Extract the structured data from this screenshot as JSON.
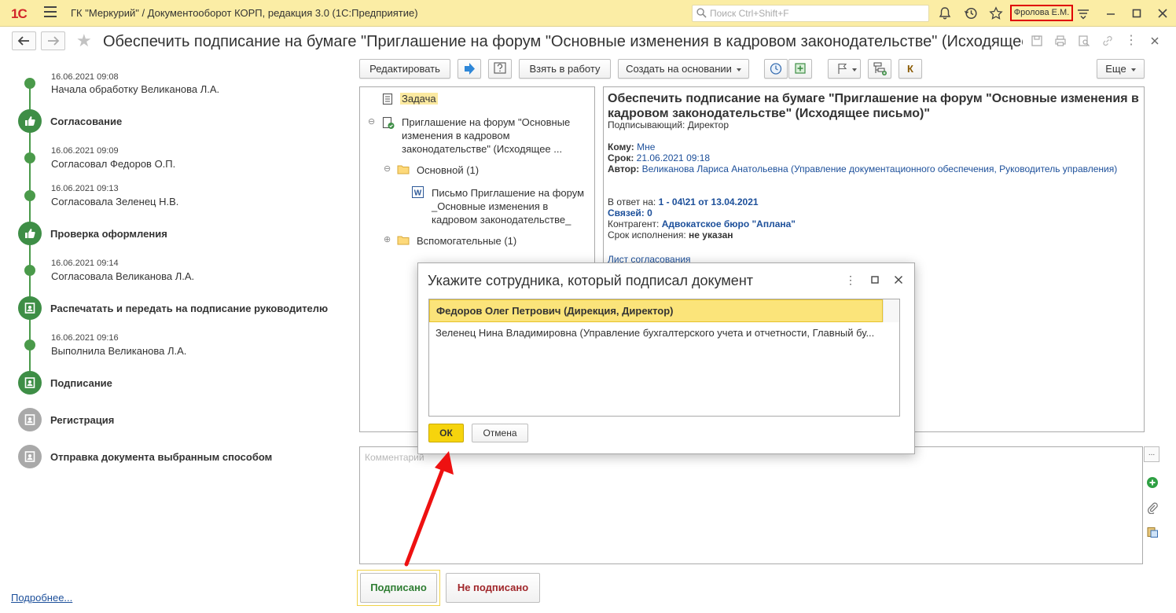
{
  "titlebar": {
    "logo": "1С",
    "app_title": "ГК \"Меркурий\" / Документооборот КОРП, редакция 3.0  (1С:Предприятие)",
    "search_placeholder": "Поиск Ctrl+Shift+F",
    "user": "Фролова Е.М."
  },
  "form": {
    "title": "Обеспечить подписание на бумаге \"Приглашение на форум \"Основные изменения в кадровом законодательстве\" (Исходящее пис..."
  },
  "timeline": {
    "entries": [
      {
        "date": "16.06.2021 09:08",
        "text": "Начала обработку Великанова Л.А."
      },
      {
        "stage": "Согласование"
      },
      {
        "date": "16.06.2021 09:09",
        "text": "Согласовал Федоров О.П."
      },
      {
        "date": "16.06.2021 09:13",
        "text": "Согласовала Зеленец Н.В."
      },
      {
        "stage": "Проверка оформления"
      },
      {
        "date": "16.06.2021 09:14",
        "text": "Согласовала Великанова Л.А."
      },
      {
        "stage": "Распечатать и передать на подписание руководителю"
      },
      {
        "date": "16.06.2021 09:16",
        "text": "Выполнила Великанова Л.А."
      },
      {
        "stage": "Подписание"
      },
      {
        "stage": "Регистрация"
      },
      {
        "stage": "Отправка документа выбранным способом"
      }
    ],
    "more_link": "Подробнее..."
  },
  "toolbar": {
    "edit": "Редактировать",
    "take_to_work": "Взять в работу",
    "create_based_on": "Создать на основании",
    "more": "Еще",
    "k_button": "К"
  },
  "tree": {
    "task": "Задача",
    "document": "Приглашение на форум \"Основные изменения в кадровом законодательстве\" (Исходящее ...",
    "main_folder": "Основной (1)",
    "file": "Письмо Приглашение на форум _Основные изменения в кадровом законодательстве_",
    "aux_folder": "Вспомогательные (1)"
  },
  "detail": {
    "title": "Обеспечить подписание на бумаге \"Приглашение на форум \"Основные изменения в кадровом законодательстве\" (Исходящее письмо)\"",
    "signer_label": "Подписывающий: Директор",
    "to_label": "Кому:",
    "to_value": "Мне",
    "deadline_label": "Срок:",
    "deadline_value": "21.06.2021 09:18",
    "author_label": "Автор:",
    "author_value": "Великанова Лариса Анатольевна (Управление документационного обеспечения, Руководитель управления)",
    "reply_label": "В ответ на:",
    "reply_value": "1 - 04\\21 от 13.04.2021",
    "links_label": "Связей: 0",
    "counterparty_label": "Контрагент:",
    "counterparty_value": "Адвокатское бюро \"Аплана\"",
    "exec_label": "Срок исполнения:",
    "exec_value": "не указан",
    "approval_sheet": "Лист согласования"
  },
  "comment": {
    "placeholder": "Комментарий",
    "dots": "..."
  },
  "actions": {
    "signed": "Подписано",
    "not_signed": "Не подписано"
  },
  "modal": {
    "title": "Укажите сотрудника, который подписал документ",
    "rows": [
      "Федоров Олег Петрович (Дирекция, Директор)",
      "Зеленец Нина Владимировна (Управление бухгалтерского учета и отчетности, Главный бу..."
    ],
    "ok": "ОК",
    "cancel": "Отмена"
  },
  "colors": {
    "titlebar_bg": "#fbeda5",
    "accent_green": "#3e8e46",
    "signed_text": "#2e7d32",
    "not_signed_text": "#a0262a",
    "ok_bg": "#f6d40d",
    "link": "#1c4f9a",
    "highlight_box": "#e00000",
    "arrow": "#ee1111"
  }
}
